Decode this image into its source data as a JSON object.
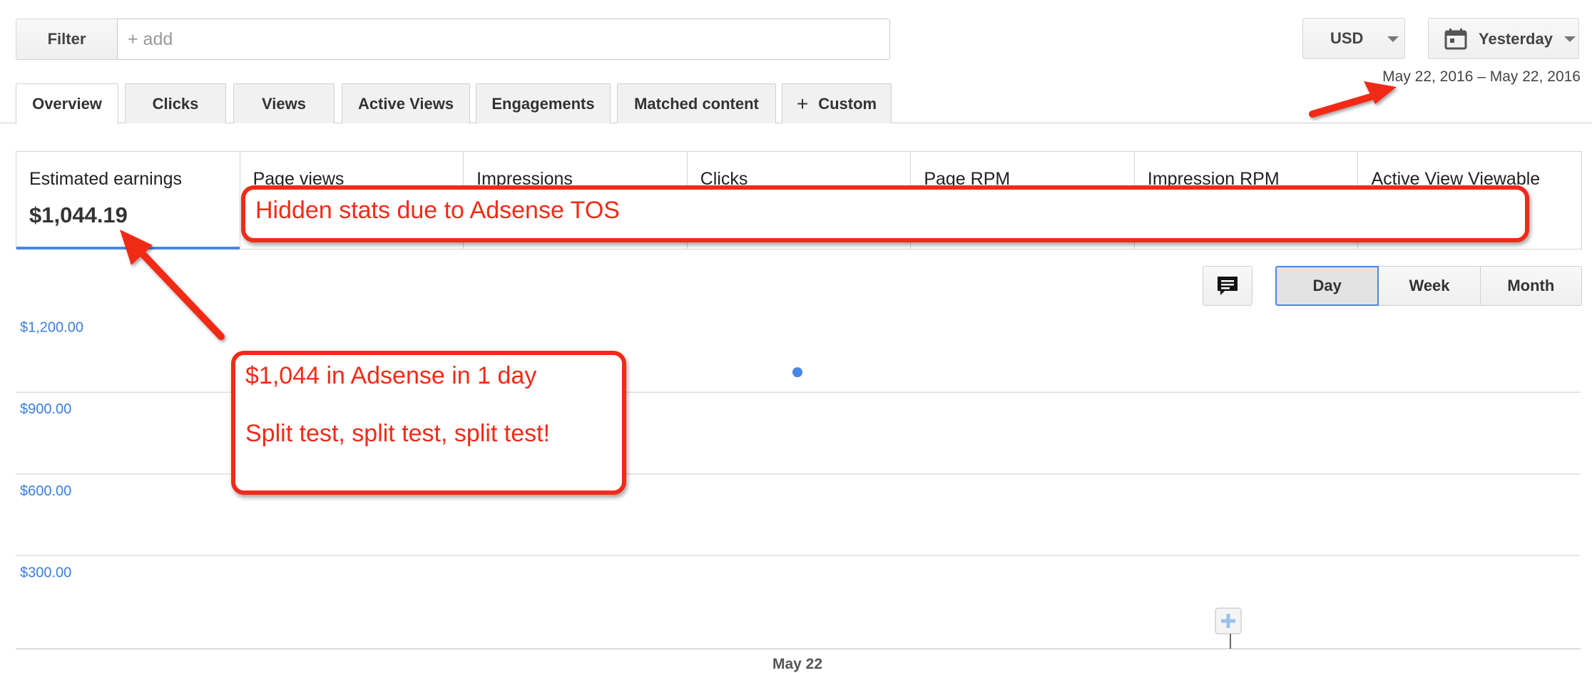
{
  "filter": {
    "label": "Filter",
    "placeholder": "+ add"
  },
  "currency": {
    "label": "USD"
  },
  "date": {
    "label": "Yesterday",
    "range": "May 22, 2016 – May 22, 2016"
  },
  "tabs": [
    {
      "label": "Overview",
      "active": true
    },
    {
      "label": "Clicks"
    },
    {
      "label": "Views"
    },
    {
      "label": "Active Views"
    },
    {
      "label": "Engagements"
    },
    {
      "label": "Matched content"
    },
    {
      "label": "Custom",
      "icon": "plus-icon"
    }
  ],
  "metrics": [
    {
      "label": "Estimated earnings",
      "value": "$1,044.19",
      "active": true
    },
    {
      "label": "Page views"
    },
    {
      "label": "Impressions"
    },
    {
      "label": "Clicks"
    },
    {
      "label": "Page RPM"
    },
    {
      "label": "Impression RPM"
    },
    {
      "label": "Active View Viewable"
    }
  ],
  "period": {
    "options": [
      "Day",
      "Week",
      "Month"
    ],
    "selected": "Day"
  },
  "chart_data": {
    "type": "scatter",
    "x": [
      "May 22"
    ],
    "series": [
      {
        "values": [
          1044.19
        ]
      }
    ],
    "yticks": [
      "$1,200.00",
      "$900.00",
      "$600.00",
      "$300.00"
    ],
    "ylim": [
      0,
      1350
    ],
    "xlabel": "",
    "ylabel": "",
    "grid": true,
    "point_color": "#4a86e8"
  },
  "annotations": {
    "hidden_stats": "Hidden stats due to Adsense TOS",
    "earnings_line1": "$1,044 in Adsense in 1 day",
    "earnings_line2": "Split test, split test, split test!",
    "color": "#f12b18"
  }
}
